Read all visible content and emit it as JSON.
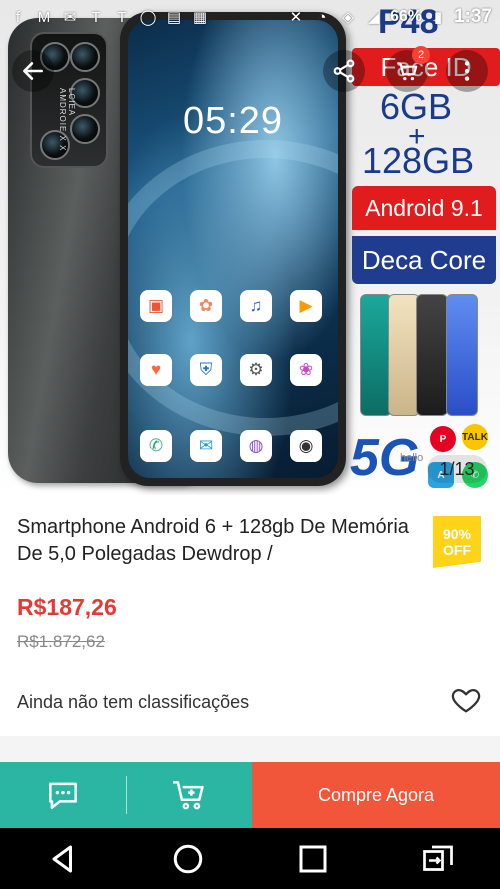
{
  "status_bar": {
    "time": "1:37",
    "battery": "66%",
    "icons": [
      "facebook-icon",
      "gmail-icon",
      "mail-icon",
      "t-icon",
      "t-icon",
      "whatsapp-icon",
      "message-icon",
      "gallery-icon",
      "mute-icon",
      "alarm-icon",
      "wifi-icon",
      "signal-3g-icon",
      "battery-icon"
    ]
  },
  "gallery": {
    "phone_screen_time": "05:29",
    "camera_brand": "LCIEA AMDROIE X X",
    "promo": {
      "model": "P48",
      "face_id": "Face ID",
      "ram": "6GB",
      "plus": "+",
      "storage": "128GB",
      "os": "Android 9.1",
      "cpu": "Deca Core",
      "network": "5G",
      "network_sub": "hello"
    },
    "page_indicator": "1/13",
    "cart_count": "2"
  },
  "product": {
    "title": "Smartphone Android 6 + 128gb De Memória De 5,0 Polegadas Dewdrop /",
    "discount_pct": "90%",
    "discount_label": "OFF",
    "price": "R$187,26",
    "old_price": "R$1.872,62",
    "rating_text": "Ainda não tem classificações"
  },
  "action_bar": {
    "buy_label": "Compre Agora"
  },
  "colors": {
    "teal": "#2bb5a3",
    "orange": "#f1563a",
    "price_red": "#e53935",
    "badge_yellow": "#ffd31a"
  }
}
